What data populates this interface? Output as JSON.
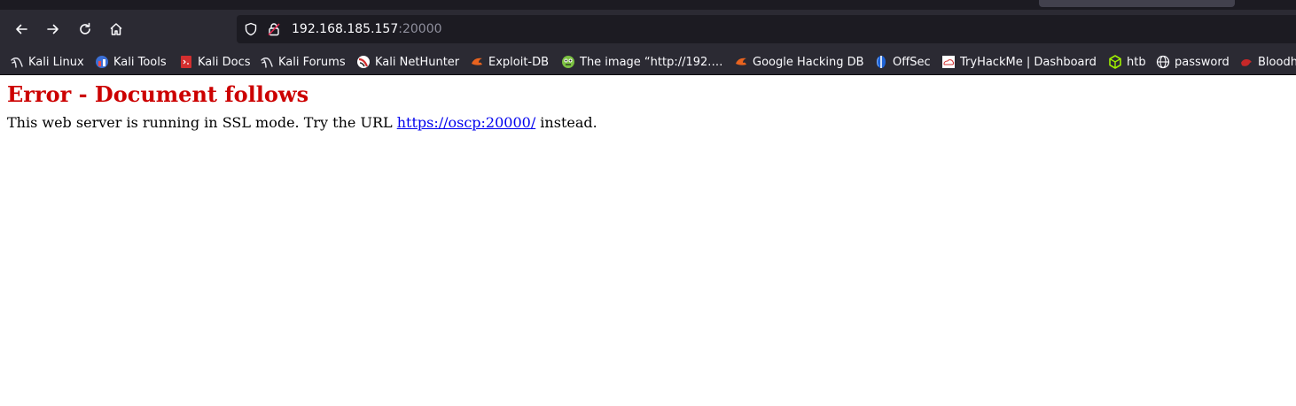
{
  "browser": {
    "url_host": "192.168.185.157",
    "url_port": ":20000"
  },
  "bookmarks": [
    {
      "label": "Kali Linux",
      "icon": "kali-dragon-icon"
    },
    {
      "label": "Kali Tools",
      "icon": "kali-tools-icon"
    },
    {
      "label": "Kali Docs",
      "icon": "kali-docs-icon"
    },
    {
      "label": "Kali Forums",
      "icon": "kali-dragon-icon"
    },
    {
      "label": "Kali NetHunter",
      "icon": "nethunter-icon"
    },
    {
      "label": "Exploit-DB",
      "icon": "exploit-db-icon"
    },
    {
      "label": "The image “http://192.…",
      "icon": "image-bookmark-icon"
    },
    {
      "label": "Google Hacking DB",
      "icon": "exploit-db-icon"
    },
    {
      "label": "OffSec",
      "icon": "offsec-icon"
    },
    {
      "label": "TryHackMe | Dashboard",
      "icon": "tryhackme-icon"
    },
    {
      "label": "htb",
      "icon": "htb-cube-icon"
    },
    {
      "label": "password",
      "icon": "globe-icon"
    },
    {
      "label": "Bloodh",
      "icon": "bloodhound-icon"
    }
  ],
  "page": {
    "title": "Error - Document follows",
    "message_before": "This web server is running in SSL mode. Try the URL ",
    "link_text": "https://oscp:20000/",
    "message_after": " instead."
  },
  "colors": {
    "title_red": "#cc0000",
    "link_blue": "#0000ee",
    "chrome_dark": "#2b2a33",
    "urlbar_bg": "#1c1b22"
  }
}
